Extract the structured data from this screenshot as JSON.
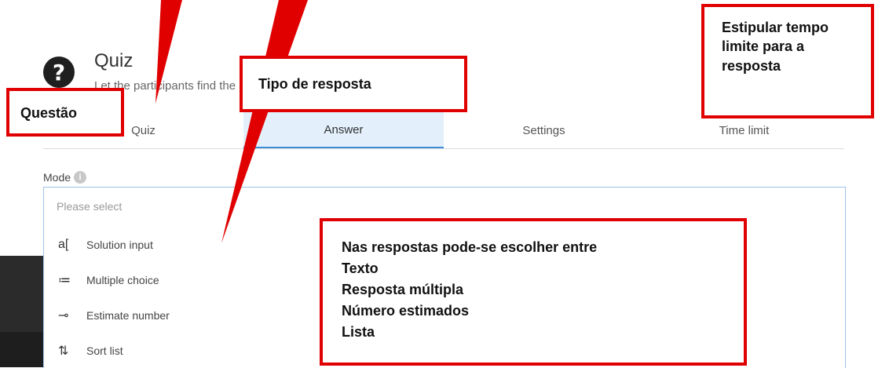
{
  "header": {
    "icon_glyph": "?",
    "title": "Quiz",
    "subtitle": "Let the participants find the answer to collect points and / or get ahead."
  },
  "tabs": [
    {
      "label": "Quiz",
      "active": false
    },
    {
      "label": "Answer",
      "active": true
    },
    {
      "label": "Settings",
      "active": false
    },
    {
      "label": "Time limit",
      "active": false
    }
  ],
  "mode": {
    "label": "Mode",
    "info_glyph": "i",
    "placeholder": "Please select",
    "options": [
      {
        "icon": "a[",
        "icon_name": "text-input-icon",
        "label": "Solution input"
      },
      {
        "icon": "≔",
        "icon_name": "list-icon",
        "label": "Multiple choice"
      },
      {
        "icon": "⊸",
        "icon_name": "slider-icon",
        "label": "Estimate number"
      },
      {
        "icon": "⇅",
        "icon_name": "sort-icon",
        "label": "Sort list"
      }
    ]
  },
  "annotations": {
    "questao": "Questão",
    "tipo": "Tipo de resposta",
    "tempo": [
      "Estipular tempo",
      "limite para a",
      "resposta"
    ],
    "respostas": [
      "Nas respostas pode-se escolher entre",
      "Texto",
      "Resposta múltipla",
      "Número estimados",
      "Lista"
    ]
  },
  "colors": {
    "annotation": "#e00000",
    "active_tab_bg": "#e3f0fb",
    "active_tab_border": "#3d8ed6"
  }
}
